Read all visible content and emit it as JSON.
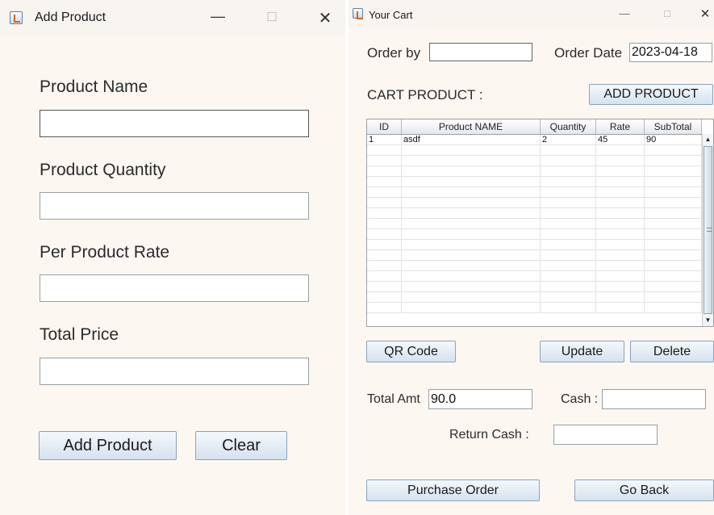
{
  "add_product_window": {
    "title": "Add Product",
    "controls": {
      "minimize": "—",
      "maximize": "□",
      "close": "✕"
    },
    "product_name_label": "Product Name",
    "product_name_value": "",
    "product_quantity_label": "Product Quantity",
    "product_quantity_value": "",
    "per_product_rate_label": "Per Product Rate",
    "per_product_rate_value": "",
    "total_price_label": "Total Price",
    "total_price_value": "",
    "add_product_button": "Add Product",
    "clear_button": "Clear"
  },
  "cart_window": {
    "title": "Your Cart",
    "controls": {
      "minimize": "—",
      "maximize": "□",
      "close": "✕"
    },
    "order_by_label": "Order by",
    "order_by_value": "",
    "order_date_label": "Order Date",
    "order_date_value": "2023-04-18",
    "cart_product_label": "CART PRODUCT :",
    "add_product_button": "ADD PRODUCT",
    "table": {
      "columns": [
        "ID",
        "Product NAME",
        "Quantity",
        "Rate",
        "SubTotal"
      ],
      "rows": [
        [
          "1",
          "asdf",
          "2",
          "45",
          "90"
        ]
      ],
      "empty_rows": 16
    },
    "scroll_arrows": {
      "up": "▲",
      "down": "▼"
    },
    "qr_code_button": "QR Code",
    "update_button": "Update",
    "delete_button": "Delete",
    "total_amt_label": "Total Amt",
    "total_amt_value": "90.0",
    "cash_label": "Cash :",
    "cash_value": "",
    "return_cash_label": "Return Cash :",
    "return_cash_value": "",
    "purchase_order_button": "Purchase Order",
    "go_back_button": "Go Back"
  }
}
